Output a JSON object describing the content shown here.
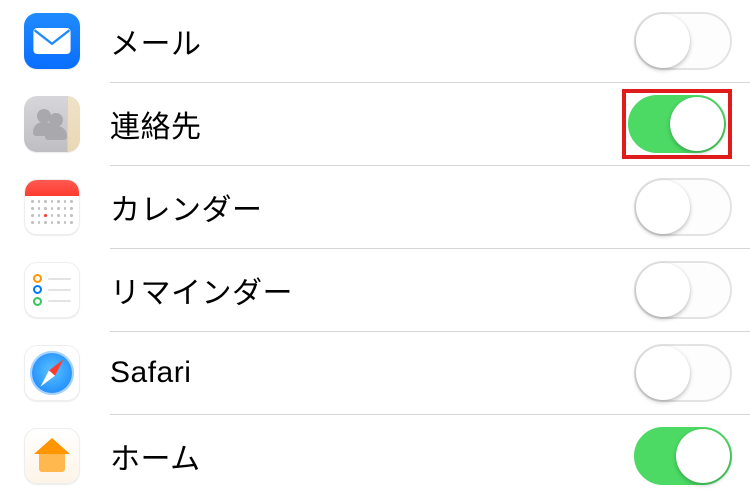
{
  "settings": {
    "rows": [
      {
        "id": "mail",
        "label": "メール",
        "enabled": false,
        "highlighted": false
      },
      {
        "id": "contacts",
        "label": "連絡先",
        "enabled": true,
        "highlighted": true
      },
      {
        "id": "calendar",
        "label": "カレンダー",
        "enabled": false,
        "highlighted": false
      },
      {
        "id": "reminders",
        "label": "リマインダー",
        "enabled": false,
        "highlighted": false
      },
      {
        "id": "safari",
        "label": "Safari",
        "enabled": false,
        "highlighted": false
      },
      {
        "id": "home",
        "label": "ホーム",
        "enabled": true,
        "highlighted": false
      }
    ]
  },
  "colors": {
    "toggle_on": "#4cd964",
    "highlight": "#e01b1b"
  }
}
